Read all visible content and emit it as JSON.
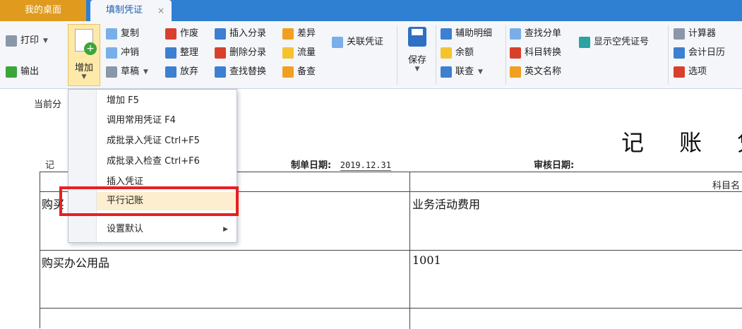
{
  "tabs": {
    "home": "我的桌面",
    "active": "填制凭证",
    "close": "×"
  },
  "ribbon": {
    "print": "打印",
    "export": "输出",
    "add": "增加",
    "copy": "复制",
    "reverse": "冲销",
    "draft": "草稿",
    "void": "作废",
    "organize": "整理",
    "abandon": "放弃",
    "insert_entry": "插入分录",
    "delete_entry": "删除分录",
    "find_replace": "查找替换",
    "difference": "差异",
    "flow": "流量",
    "memo": "备查",
    "linked_voucher": "关联凭证",
    "save": "保存",
    "aux_detail": "辅助明细",
    "balance": "余额",
    "query": "联查",
    "find_entry": "查找分单",
    "account_convert": "科目转换",
    "english_name": "英文名称",
    "show_empty_no": "显示空凭证号",
    "calculator": "计算器",
    "calendar": "会计日历",
    "options": "选项"
  },
  "menu": {
    "items": [
      {
        "label": "增加 F5"
      },
      {
        "label": "调用常用凭证 F4"
      },
      {
        "label": "成批录入凭证 Ctrl+F5"
      },
      {
        "label": "成批录入检查 Ctrl+F6"
      },
      {
        "label": "插入凭证"
      },
      {
        "label": "平行记账"
      },
      {
        "label": "设置默认"
      }
    ]
  },
  "document": {
    "current_label": "当前分",
    "title": "记 账 凭",
    "type_prefix": "记",
    "date_label": "制单日期:",
    "date_value": "2019.12.31",
    "review_label": "审核日期:",
    "account_header": "科目名",
    "rows": [
      {
        "summary": "购买",
        "account": "业务活动费用"
      },
      {
        "summary": "购买办公用品",
        "account": "1001"
      }
    ]
  }
}
